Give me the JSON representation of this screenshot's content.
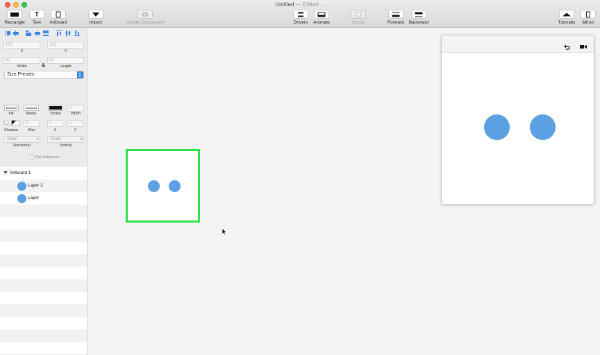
{
  "window": {
    "title": "Untitled",
    "title_separator": "—",
    "edited_label": "Edited",
    "edited_chevron": "⌄"
  },
  "toolbar": {
    "rectangle": "Rectangle",
    "text": "Text",
    "text_glyph": "T",
    "artboard": "Artboard",
    "import": "Import",
    "create_component": "Create Component",
    "drivers": "Drivers",
    "animate": "Animate",
    "group": "Group",
    "forward": "Forward",
    "backward": "Backward",
    "tutorials": "Tutorials",
    "mirror": "Mirror"
  },
  "inspector": {
    "x_value": "103",
    "x_label": "X",
    "y_value": "153",
    "y_label": "Y",
    "width_value": "60",
    "width_label": "Width",
    "height_value": "60",
    "height_label": "Height",
    "size_presets": "Size Presets",
    "fill_label": "Fill",
    "media_label": "Media",
    "stroke_label": "Stroke",
    "stroke_width_value": "0",
    "stroke_width_label": "Width",
    "shadow_label": "Shadow",
    "blur_value": "4",
    "blur_label": "Blur",
    "shadow_x_value": "0",
    "shadow_x_label": "X",
    "shadow_y_value": "2",
    "shadow_y_label": "Y",
    "horizontal_value": "Static",
    "horizontal_label": "Horizontal",
    "vertical_value": "Static",
    "vertical_label": "Vertical",
    "clip_sublayers": "Clip Sublayers"
  },
  "layers": [
    {
      "name": "Artboard 1"
    },
    {
      "name": "Layer 2"
    },
    {
      "name": "Layer"
    }
  ],
  "colors": {
    "accent": "#3a86e0",
    "layer_fill": "#5aa0e3",
    "artboard_selection": "#2ee24a"
  }
}
